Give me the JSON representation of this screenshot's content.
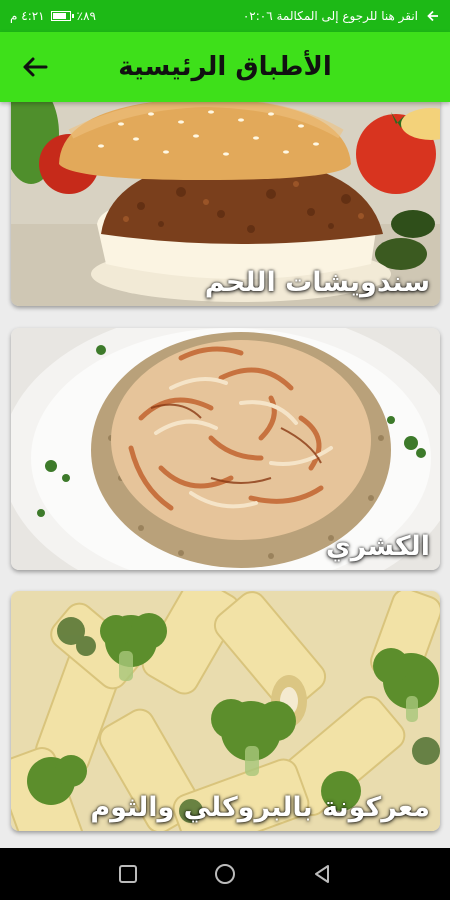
{
  "status_bar": {
    "time": "٤:٢١ م",
    "battery": "٪٨٩",
    "battery_level": 0.89,
    "call_notice": "انقر هنا للرجوع إلى المكالمة ٠٢:٠٦",
    "icons": [
      "battery-icon",
      "back-arrow-icon"
    ]
  },
  "app_bar": {
    "title": "الأطباق الرئيسية",
    "back_icon": "arrow-back-icon"
  },
  "dishes": [
    {
      "label": "سندويشات اللحم",
      "image": "meat-sandwich-photo"
    },
    {
      "label": "الكشري",
      "image": "koshari-photo"
    },
    {
      "label": "معركونة بالبروكلي والثوم",
      "image": "pasta-broccoli-photo"
    }
  ],
  "nav_bar": {
    "icons": [
      "recent-apps-icon",
      "home-icon",
      "back-triangle-icon"
    ]
  },
  "colors": {
    "status_bar": "#1db916",
    "app_bar": "#3ee01a",
    "background": "#ececec",
    "nav_bar": "#000000"
  }
}
